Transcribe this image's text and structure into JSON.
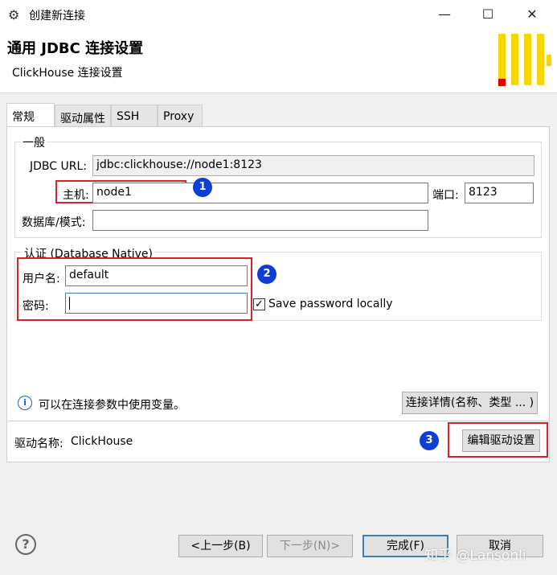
{
  "window": {
    "title": "创建新连接",
    "minimize": "—",
    "maximize": "☐",
    "close": "✕"
  },
  "header": {
    "title": "通用 JDBC 连接设置",
    "subtitle": "ClickHouse 连接设置",
    "logo_colors": {
      "bars": "#f5d800",
      "dot": "#e00000"
    }
  },
  "tabs": [
    {
      "label": "常规",
      "active": true
    },
    {
      "label": "驱动属性"
    },
    {
      "label": "SSH"
    },
    {
      "label": "Proxy"
    }
  ],
  "general": {
    "group_label": "一般",
    "jdbc_url_label": "JDBC URL:",
    "jdbc_url_value": "jdbc:clickhouse://node1:8123",
    "host_label": "主机:",
    "host_value": "node1",
    "port_label": "端口:",
    "port_value": "8123",
    "database_label": "数据库/模式:",
    "database_value": ""
  },
  "auth": {
    "group_label": "认证 (Database Native)",
    "username_label": "用户名:",
    "username_value": "default",
    "password_label": "密码:",
    "password_value": "",
    "save_password_label": "Save password locally",
    "save_password_checked": true
  },
  "badges": [
    "1",
    "2",
    "3"
  ],
  "info": {
    "text": "可以在连接参数中使用变量。",
    "details_button": "连接详情(名称、类型 ... )"
  },
  "driver": {
    "label": "驱动名称:",
    "name": "ClickHouse",
    "edit_button": "编辑驱动设置"
  },
  "footer": {
    "help": "?",
    "back": "<上一步(B)",
    "next": "下一步(N)>",
    "finish": "完成(F)",
    "cancel": "取消"
  },
  "watermark": "知乎 @Lansonli",
  "colors": {
    "highlight_box": "#d9212a",
    "badge": "#0d3fd6",
    "info": "#1565c0"
  }
}
